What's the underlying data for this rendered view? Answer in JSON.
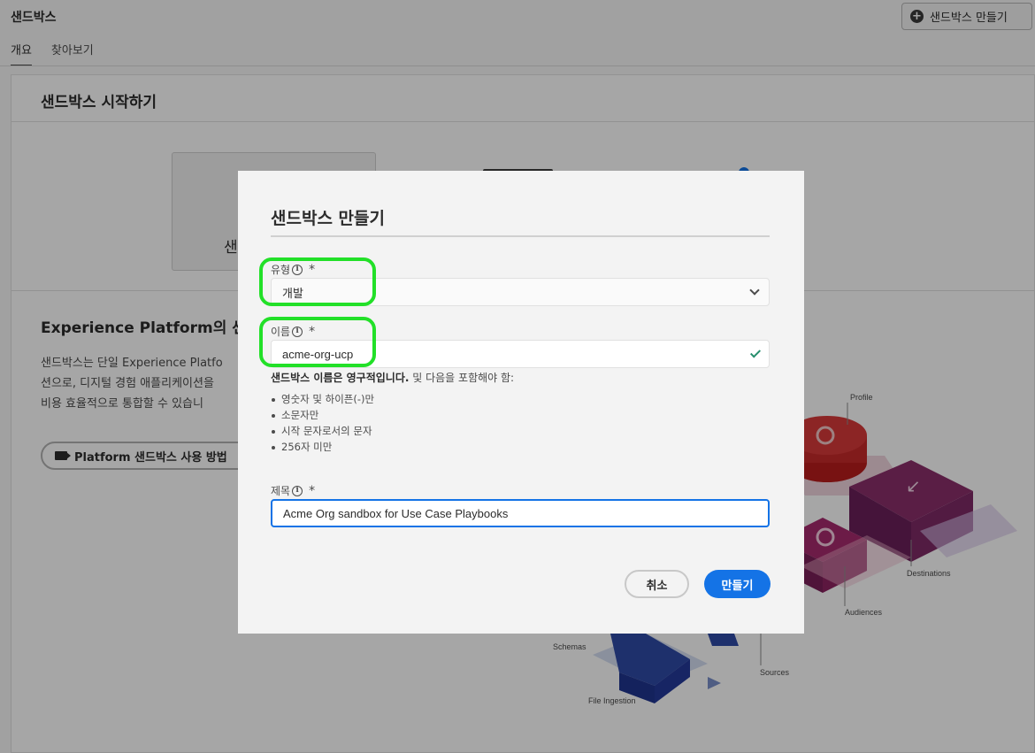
{
  "app": {
    "title": "샌드박스",
    "create_button": "샌드박스 만들기"
  },
  "tabs": [
    {
      "label": "개요",
      "active": true
    },
    {
      "label": "찾아보기",
      "active": false
    }
  ],
  "card": {
    "title": "샌드박스 시작하기",
    "tile_label": "샌",
    "section_heading": "Experience Platform의 샌",
    "section_body": [
      "샌드박스는 단일 Experience Platfo",
      "션으로, 디지털 경험 애플리케이션을",
      "비용 효율적으로 통합할 수 있습니"
    ],
    "video_button": "Platform 샌드박스 사용 방법"
  },
  "diagram_labels": {
    "profile": "Profile",
    "destinations": "Destinations",
    "audiences": "Audiences",
    "schemas": "Schemas",
    "sources": "Sources",
    "file_ingestion": "File Ingestion"
  },
  "dialog": {
    "title": "샌드박스 만들기",
    "type_label": "유형",
    "type_value": "개발",
    "name_label": "이름",
    "name_value": "acme-org-ucp",
    "name_hint_bold": "샌드박스 이름은 영구적입니다.",
    "name_hint_rest": " 및 다음을 포함해야 함:",
    "name_rules": [
      "영숫자 및 하이픈(-)만",
      "소문자만",
      "시작 문자로서의 문자",
      "256자 미만"
    ],
    "title_label": "제목",
    "title_value": "Acme Org sandbox for Use Case Playbooks",
    "required_mark": "*",
    "cancel_label": "취소",
    "create_label": "만들기"
  },
  "colors": {
    "accent": "#1473e6",
    "highlight": "#22e028",
    "valid": "#268e6c"
  }
}
